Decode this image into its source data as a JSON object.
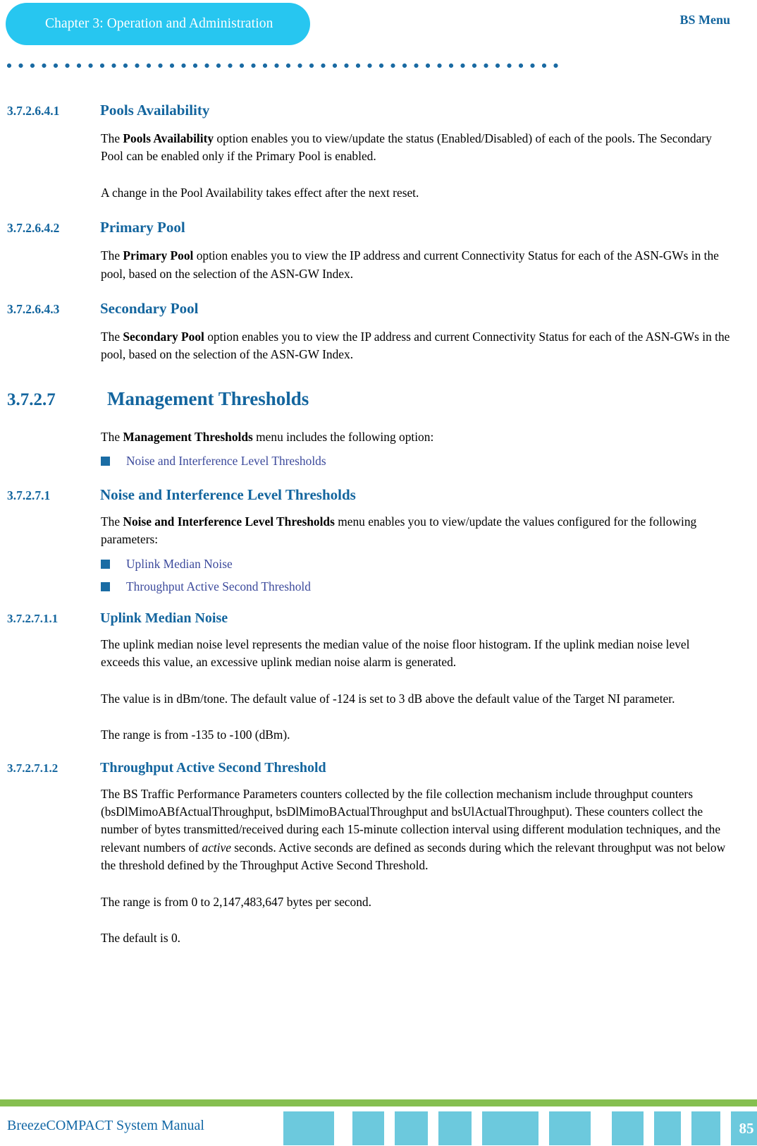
{
  "header": {
    "chapter_pill": "Chapter 3: Operation and Administration",
    "right_label": "BS Menu",
    "pill_color": "#27c6f0",
    "right_label_color": "#13659e",
    "rule_dot_color": "#1b6ba3"
  },
  "sections": [
    {
      "number": "3.7.2.6.4.1",
      "title": "Pools Availability",
      "level": 4
    },
    {
      "number": "3.7.2.6.4.2",
      "title": "Primary Pool",
      "level": 4
    },
    {
      "number": "3.7.2.6.4.3",
      "title": "Secondary Pool",
      "level": 4
    },
    {
      "number": "3.7.2.7",
      "title": "Management Thresholds",
      "level": 3
    },
    {
      "number": "3.7.2.7.1",
      "title": "Noise and Interference Level Thresholds",
      "level": 4
    },
    {
      "number": "3.7.2.7.1.1",
      "title": "Uplink Median Noise",
      "level": 5
    },
    {
      "number": "3.7.2.7.1.2",
      "title": "Throughput Active Second Threshold",
      "level": 5
    }
  ],
  "paragraphs": {
    "pools_availability_1_pre": "The ",
    "pools_availability_1_bold": "Pools Availability",
    "pools_availability_1_post": " option enables you to view/update the status (Enabled/Disabled) of each of the pools. The Secondary Pool can be enabled only if the Primary Pool is enabled.",
    "pools_availability_2": "A change in the Pool Availability takes effect after the next reset.",
    "primary_pool_pre": "The ",
    "primary_pool_bold": "Primary Pool",
    "primary_pool_post": " option enables you to view the IP address and current Connectivity Status for each of the ASN-GWs in the pool, based on the selection of the ASN-GW Index.",
    "secondary_pool_pre": "The ",
    "secondary_pool_bold": "Secondary Pool",
    "secondary_pool_post": " option enables you to view the IP address and current Connectivity Status for each of the ASN-GWs in the pool, based on the selection of the ASN-GW Index.",
    "mgmt_thresholds_pre": "The ",
    "mgmt_thresholds_bold": "Management Thresholds",
    "mgmt_thresholds_post": " menu includes the following option:",
    "noise_thresholds_pre": "The ",
    "noise_thresholds_bold": "Noise and Interference Level Thresholds",
    "noise_thresholds_post": " menu enables you to view/update the values configured for the following parameters:",
    "uplink_median_1": "The uplink median noise level represents the median value of the noise floor histogram. If the uplink median noise level exceeds this value, an excessive uplink median noise alarm is generated.",
    "uplink_median_2": "The value is in dBm/tone. The default value of -124 is set to 3 dB above the default value of the Target NI parameter.",
    "uplink_median_3": "The range is from -135 to -100 (dBm).",
    "throughput_1_a": "The BS Traffic Performance Parameters counters collected by the file collection mechanism include throughput counters (bsDlMimoABfActualThroughput, bsDlMimoBActualThroughput and bsUlActualThroughput). These counters collect the number of bytes transmitted/received during each 15-minute collection interval using different modulation techniques, and the relevant numbers of ",
    "throughput_1_italic": "active",
    "throughput_1_b": " seconds. Active seconds are defined as seconds during which the relevant throughput was not below the threshold defined by the Throughput Active Second Threshold.",
    "throughput_2": "The range is from 0 to 2,147,483,647 bytes per second.",
    "throughput_3": "The default is 0."
  },
  "bullets": {
    "mgmt_thresholds_options": [
      "Noise and Interference Level Thresholds"
    ],
    "noise_threshold_params": [
      "Uplink Median Noise",
      "Throughput Active Second Threshold"
    ],
    "marker_color": "#1a6ca4",
    "label_color": "#3c4a9c"
  },
  "footer": {
    "manual_title": "BreezeCOMPACT System Manual",
    "page_number": "85",
    "green_bar_color": "#86bf50",
    "block_color": "#6cc9dd",
    "manual_title_color": "#1267a5",
    "block_widths": [
      72,
      45,
      47,
      47,
      80,
      59,
      45,
      38,
      41,
      44
    ]
  }
}
